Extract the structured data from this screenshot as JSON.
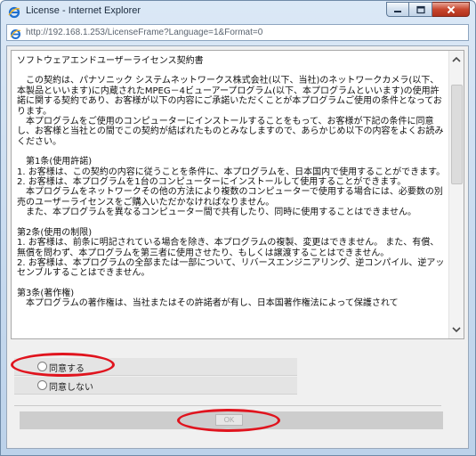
{
  "window": {
    "title": "License - Internet Explorer",
    "url": "http://192.168.1.253/LicenseFrame?Language=1&Format=0"
  },
  "license": {
    "heading": "ソフトウェアエンドユーザーライセンス契約書",
    "paragraphs": [
      "　この契約は、パナソニック システムネットワークス株式会社(以下、当社)のネットワークカメラ(以下、本製品といいます)に内蔵されたMPEG－4ビューアープログラム(以下、本プログラムといいます)の使用許諾に関する契約であり、お客様が以下の内容にご承諾いただくことが本プログラムご使用の条件となっております。\n　本プログラムをご使用のコンピューターにインストールすることをもって、お客様が下記の条件に同意し、お客様と当社との間でこの契約が結ばれたものとみなしますので、あらかじめ以下の内容をよくお読みください。",
      "　第1条(使用許諾)\n1. お客様は、この契約の内容に従うことを条件に、本プログラムを、日本国内で使用することができます。\n2. お客様は、本プログラムを1台のコンピューターにインストールして使用することができます。\n　本プログラムをネットワークその他の方法により複数のコンピューターで使用する場合には、必要数の別売のユーザーライセンスをご購入いただかなければなりません。\n　また、本プログラムを異なるコンピューター間で共有したり、同時に使用することはできません。",
      "第2条(使用の制限)\n1. お客様は、前条に明記されている場合を除き、本プログラムの複製、変更はできません。 また、有償、無償を問わず、本プログラムを第三者に使用させたり、もしくは譲渡することはできません。\n2. お客様は、本プログラムの全部または一部について、リバースエンジニアリング、逆コンパイル、逆アッセンブルすることはできません。",
      "第3条(著作権)\n　本プログラムの著作権は、当社またはその許諾者が有し、日本国著作権法によって保護されて"
    ]
  },
  "options": {
    "agree_label": "同意する",
    "disagree_label": "同意しない",
    "selected": null
  },
  "ok_button": {
    "label": "OK",
    "enabled": false
  },
  "colors": {
    "annotation": "#e0141e",
    "close_button": "#c8472f"
  },
  "icons": {
    "title": "ie-logo-icon",
    "address": "ie-page-icon",
    "minimize": "minimize-icon",
    "maximize": "maximize-icon",
    "close": "close-icon"
  }
}
